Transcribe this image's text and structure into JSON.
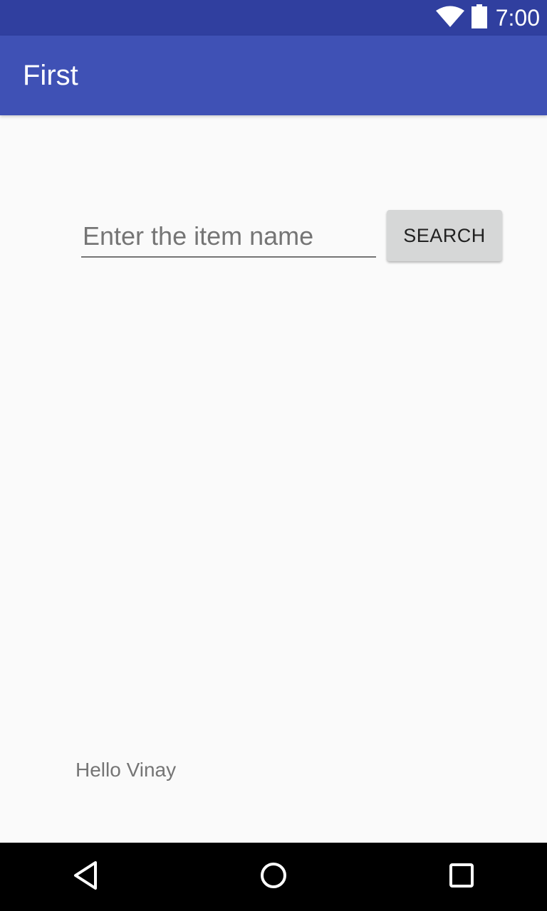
{
  "status_bar": {
    "time": "7:00",
    "icons": [
      "wifi-icon",
      "battery-icon"
    ],
    "background_color": "#303f9f"
  },
  "app_bar": {
    "title": "First",
    "background_color": "#3f51b5"
  },
  "search": {
    "placeholder": "Enter the item name",
    "value": "",
    "button_label": "SEARCH"
  },
  "greeting_text": "Hello Vinay",
  "nav_bar": {
    "icons": [
      "back-icon",
      "home-icon",
      "recents-icon"
    ]
  }
}
